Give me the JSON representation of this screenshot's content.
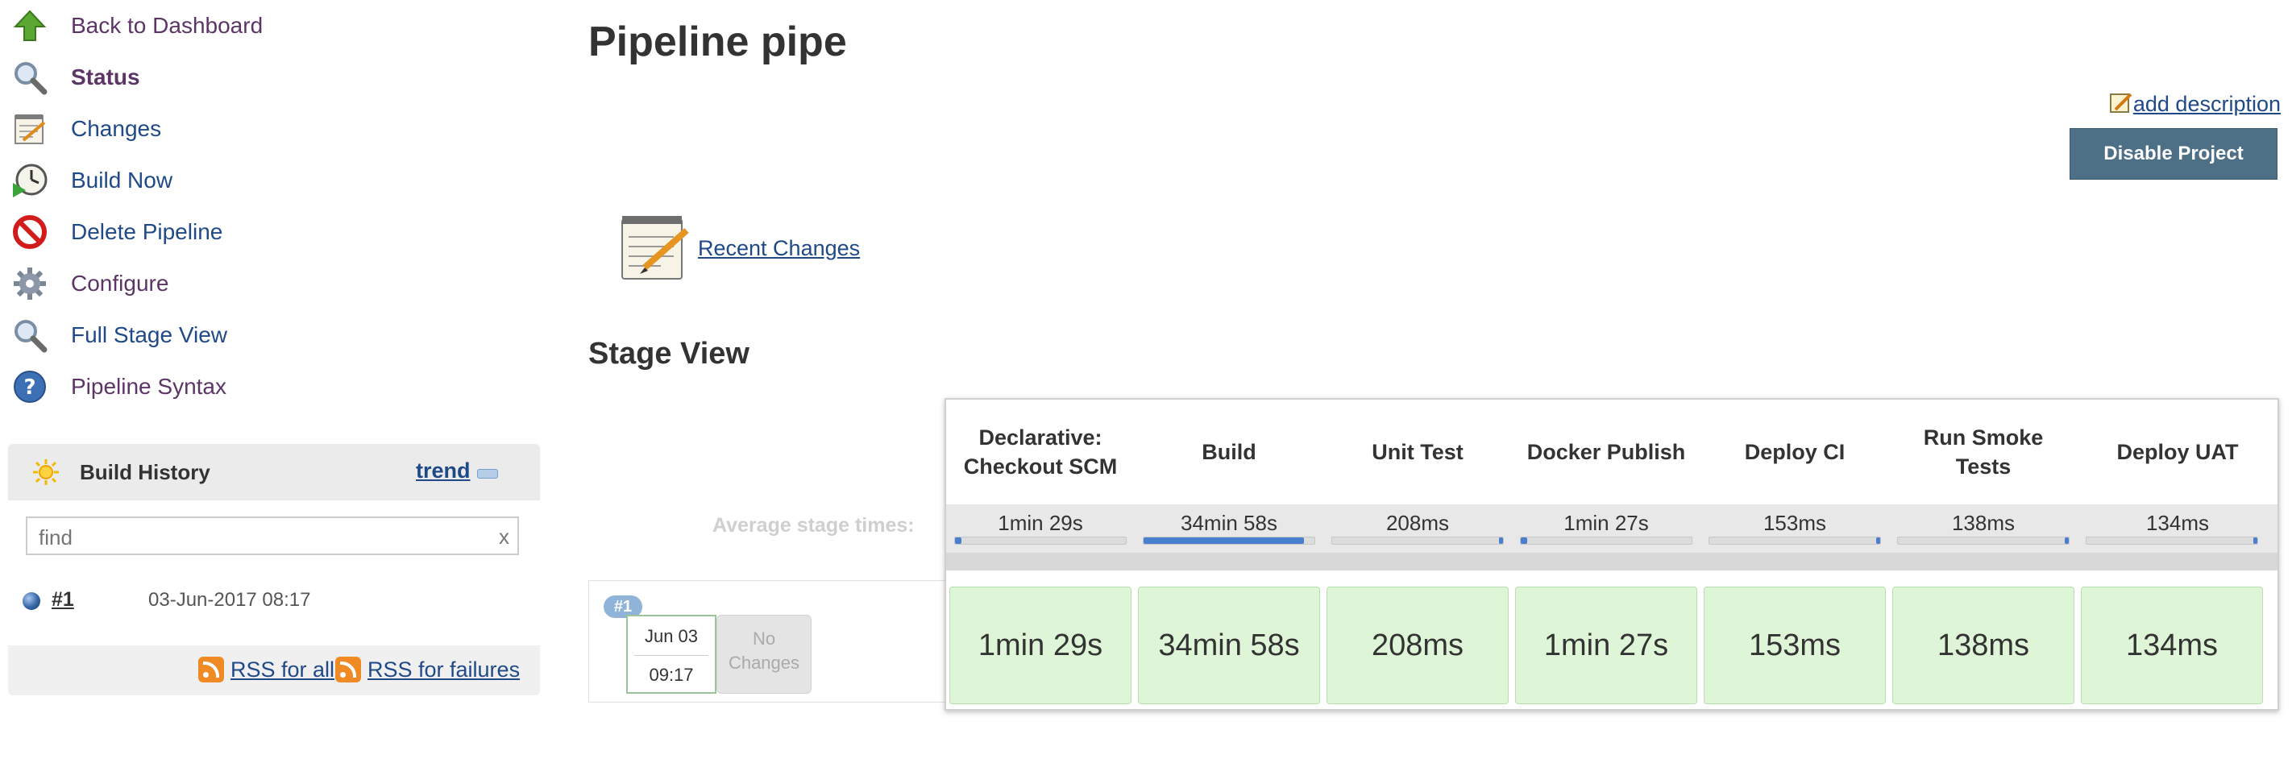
{
  "sidebar": {
    "tasks": [
      {
        "label": "Back to Dashboard",
        "icon": "up-arrow-icon"
      },
      {
        "label": "Status",
        "icon": "magnifier-icon"
      },
      {
        "label": "Changes",
        "icon": "notepad-icon"
      },
      {
        "label": "Build Now",
        "icon": "clock-play-icon"
      },
      {
        "label": "Delete Pipeline",
        "icon": "no-entry-icon"
      },
      {
        "label": "Configure",
        "icon": "gear-icon"
      },
      {
        "label": "Full Stage View",
        "icon": "magnifier-icon"
      },
      {
        "label": "Pipeline Syntax",
        "icon": "help-icon"
      }
    ],
    "build_history": {
      "title": "Build History",
      "trend_label": "trend",
      "find_placeholder": "find",
      "clear_label": "x",
      "builds": [
        {
          "number": "#1",
          "date": "03-Jun-2017 08:17"
        }
      ],
      "rss_all_label": "RSS for all",
      "rss_failures_label": "RSS for failures"
    }
  },
  "main": {
    "title": "Pipeline pipe",
    "add_description_label": "add description",
    "disable_button_label": "Disable Project",
    "recent_changes_label": "Recent Changes",
    "stage_view_title": "Stage View",
    "average_label": "Average stage times:",
    "run": {
      "badge": "#1",
      "date": "Jun 03",
      "time": "09:17",
      "no_changes_line1": "No",
      "no_changes_line2": "Changes"
    },
    "stages": [
      {
        "name": "Declarative: Checkout SCM",
        "avg": "1min 29s",
        "duration": "1min 29s",
        "avg_fraction": 0.04
      },
      {
        "name": "Build",
        "avg": "34min 58s",
        "duration": "34min 58s",
        "avg_fraction": 0.94
      },
      {
        "name": "Unit Test",
        "avg": "208ms",
        "duration": "208ms",
        "avg_fraction": 0.0
      },
      {
        "name": "Docker Publish",
        "avg": "1min 27s",
        "duration": "1min 27s",
        "avg_fraction": 0.04
      },
      {
        "name": "Deploy CI",
        "avg": "153ms",
        "duration": "153ms",
        "avg_fraction": 0.0
      },
      {
        "name": "Run Smoke Tests",
        "avg": "138ms",
        "duration": "138ms",
        "avg_fraction": 0.0
      },
      {
        "name": "Deploy UAT",
        "avg": "134ms",
        "duration": "134ms",
        "avg_fraction": 0.0
      }
    ],
    "colors": {
      "success_cell": "#dff5d7",
      "button": "#4d7087",
      "link": "#204a87",
      "visited_link": "#5c3566"
    }
  }
}
